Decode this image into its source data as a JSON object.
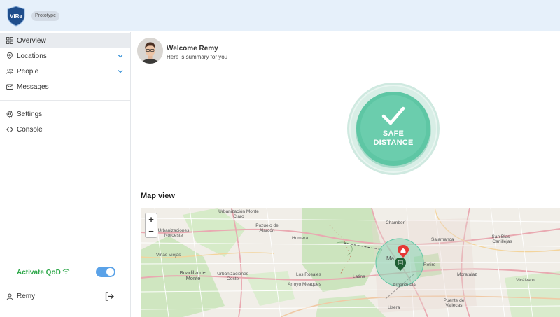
{
  "app": {
    "logo_text": "ViRe",
    "badge": "Prototype"
  },
  "sidebar": {
    "items": [
      {
        "label": "Overview",
        "icon": "grid-icon",
        "active": true
      },
      {
        "label": "Locations",
        "icon": "location-pin-icon",
        "expandable": true
      },
      {
        "label": "People",
        "icon": "people-icon",
        "expandable": true
      },
      {
        "label": "Messages",
        "icon": "envelope-icon"
      },
      {
        "label": "Settings",
        "icon": "gear-icon"
      },
      {
        "label": "Console",
        "icon": "code-icon"
      }
    ],
    "qod_label": "Activate QoD",
    "qod_enabled": true,
    "user_name": "Remy"
  },
  "header": {
    "welcome": "Welcome Remy",
    "summary": "Here is summary for you"
  },
  "status": {
    "line1": "SAFE",
    "line2": "DISTANCE",
    "color": "#5ec6a4"
  },
  "map": {
    "title": "Map view",
    "zoom_in": "+",
    "zoom_out": "−",
    "labels": [
      "Urbanización Monte Claro",
      "Pozuelo de Alarcón",
      "Humera",
      "Chamberí",
      "Salamanca",
      "Urbanizaciones Noroeste",
      "Viñas Viejas",
      "Boadilla del Monte",
      "Urbanizaciones Oeste",
      "Los Rosales",
      "Arroyo Meaques",
      "Latina",
      "Retiro",
      "Arganzuela",
      "Usera",
      "Puente de Vallecas",
      "San Blas - Canillejas",
      "Moratalaz",
      "Vicálvaro",
      "Ma"
    ]
  },
  "colors": {
    "accent": "#5aa2e8",
    "qod_green": "#2ea84a",
    "topbar": "#e6f0fa"
  }
}
